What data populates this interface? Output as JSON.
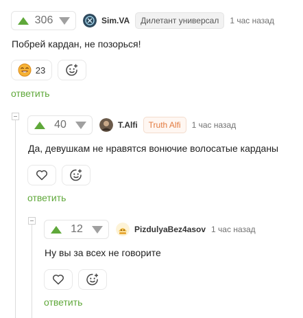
{
  "comments": [
    {
      "score": "306",
      "author": "Sim.VA",
      "badge": "Дилетант универсал",
      "time": "1 час назад",
      "text": "Побрей кардан, не позорься!",
      "reaction_count": "23",
      "reply_label": "ответить"
    },
    {
      "score": "40",
      "author": "T.Alfi",
      "badge": "Truth Alfi",
      "time": "1 час назад",
      "text": "Да, девушкам не нравятся вонючие волосатые карданы",
      "reply_label": "ответить"
    },
    {
      "score": "12",
      "author": "PizdulyaBez4asov",
      "time": "1 час назад",
      "text": "Ну вы за всех не говорите",
      "reply_label": "ответить"
    }
  ],
  "colors": {
    "accent_green": "#5fa83a",
    "badge_orange": "#e27a3f"
  },
  "icons": [
    "heart-icon",
    "add-reaction-icon",
    "laughing-emoji-icon",
    "collapse-thread-icon"
  ]
}
